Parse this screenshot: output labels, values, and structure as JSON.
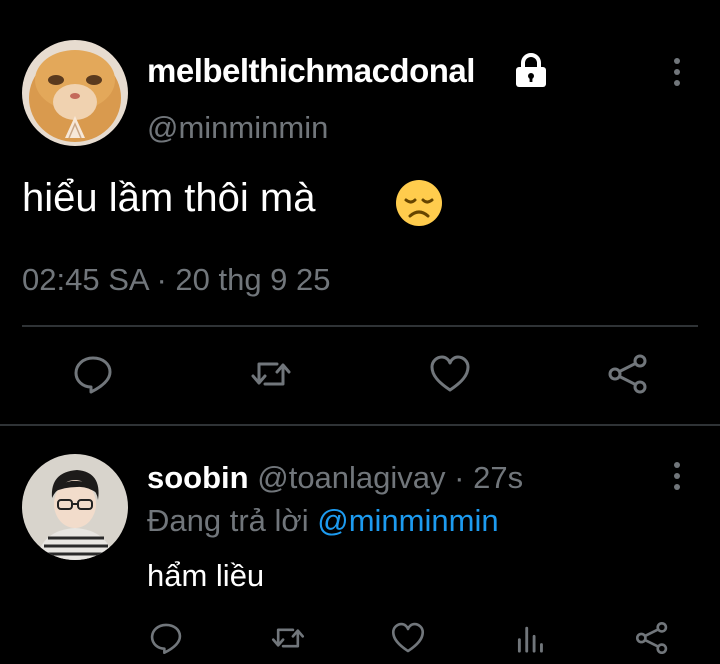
{
  "main_tweet": {
    "display_name": "melbelthichmacdonal",
    "handle": "@minminmin",
    "text": "hiểu lầm thôi mà",
    "emoji": "disappointed-face",
    "timestamp": "02:45 SA · 20 thg 9 25",
    "protected": true
  },
  "actions": [
    "reply-icon",
    "retweet-icon",
    "like-icon",
    "share-icon"
  ],
  "reply_tweet": {
    "display_name": "soobin",
    "handle": "@toanlagivay",
    "time": "· 27s",
    "replying_prefix": "Đang trả lời",
    "replying_to": "@minminmin",
    "text": "hẩm liều",
    "actions": [
      "reply-icon",
      "retweet-icon",
      "like-icon",
      "views-icon",
      "share-icon"
    ]
  },
  "colors": {
    "background": "#000000",
    "text": "#ffffff",
    "muted": "#71767b",
    "accent": "#1d9bf0",
    "divider": "#2f3336"
  }
}
